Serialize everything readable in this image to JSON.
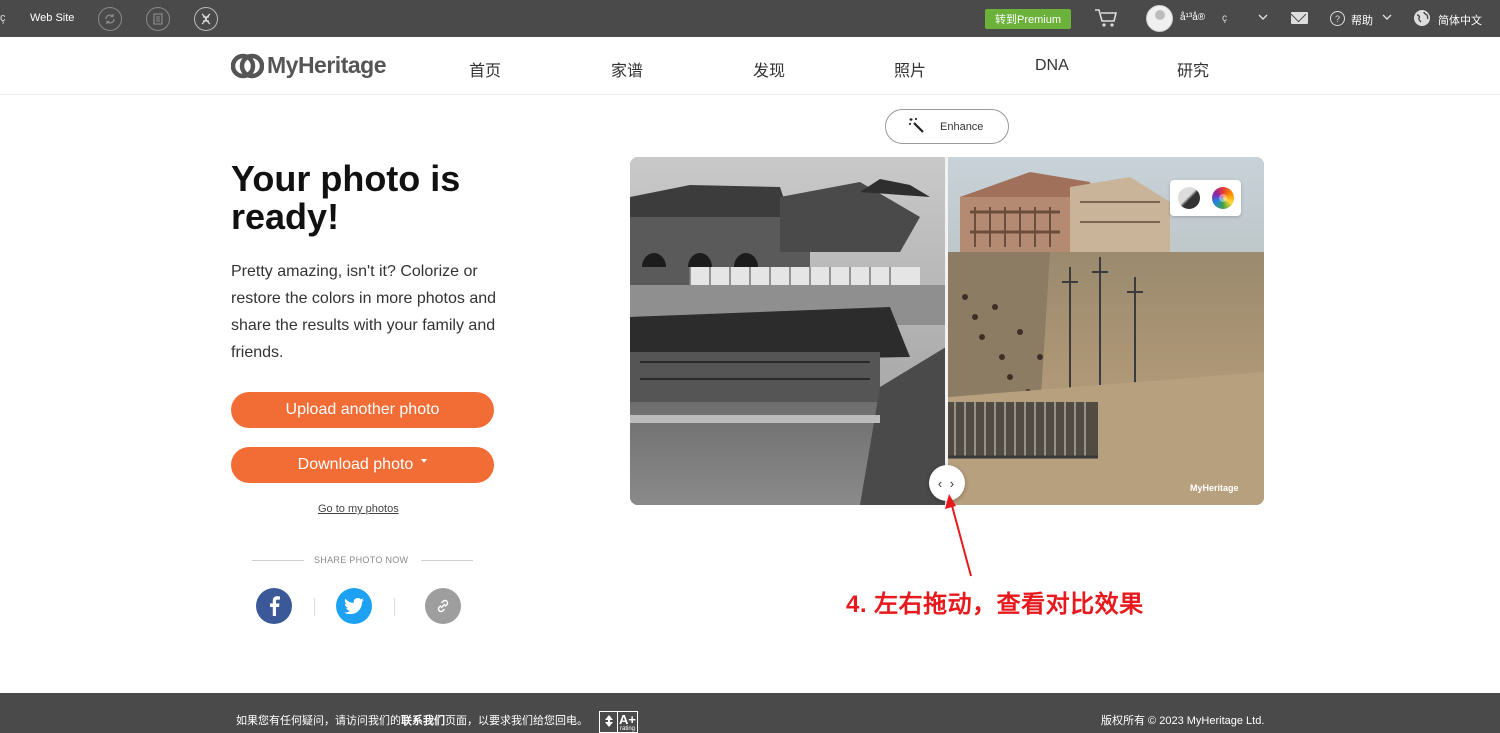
{
  "topbar": {
    "left_glyph": "ç",
    "site_label": "Web Site",
    "premium_label": "转到Premium",
    "user_name": "å¹³å®",
    "user_glyph": "ç",
    "help_label": "帮助",
    "language_label": "简体中文"
  },
  "nav": {
    "logo_text": "MyHeritage",
    "items": [
      "首页",
      "家谱",
      "发现",
      "照片",
      "DNA",
      "研究"
    ]
  },
  "main": {
    "headline": "Your photo is ready!",
    "description": "Pretty amazing, isn't it? Colorize or restore the colors in more photos and share the results with your family and friends.",
    "upload_button": "Upload another photo",
    "download_button": "Download photo",
    "go_to_photos": "Go to my photos",
    "share_label": "SHARE PHOTO NOW"
  },
  "photo": {
    "enhance_label": "Enhance",
    "handle_glyph": "‹ ›",
    "watermark": "MyHeritage"
  },
  "annotation": {
    "text": "4. 左右拖动，查看对比效果",
    "color": "#e8191c"
  },
  "footer": {
    "contact_pre": "如果您有任何疑问，请访问我们的",
    "contact_link": "联系我们",
    "contact_post": "页面，以要求我们给您回电。",
    "bbb_grade": "A+",
    "bbb_sub": "rating",
    "copyright": "版权所有 © 2023 MyHeritage Ltd."
  },
  "colors": {
    "topbar_bg": "#4a4a4a",
    "premium_green": "#6bb13a",
    "brand_orange": "#f26c35",
    "facebook": "#3b5998",
    "twitter": "#1da1f2",
    "link_grey": "#9e9e9e"
  }
}
